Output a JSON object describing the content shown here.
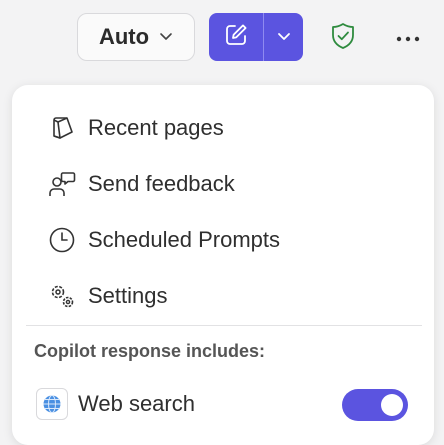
{
  "toolbar": {
    "mode_label": "Auto"
  },
  "menu": {
    "items": [
      {
        "label": "Recent pages",
        "icon": "book-icon"
      },
      {
        "label": "Send feedback",
        "icon": "feedback-icon"
      },
      {
        "label": "Scheduled Prompts",
        "icon": "clock-icon"
      },
      {
        "label": "Settings",
        "icon": "gear-icon"
      }
    ],
    "section_label": "Copilot response includes:",
    "web_search": {
      "label": "Web search",
      "enabled": true,
      "icon": "globe-icon"
    }
  },
  "colors": {
    "accent": "#5b54e0",
    "shield": "#2e8b3e",
    "background": "#f3f3f4"
  }
}
